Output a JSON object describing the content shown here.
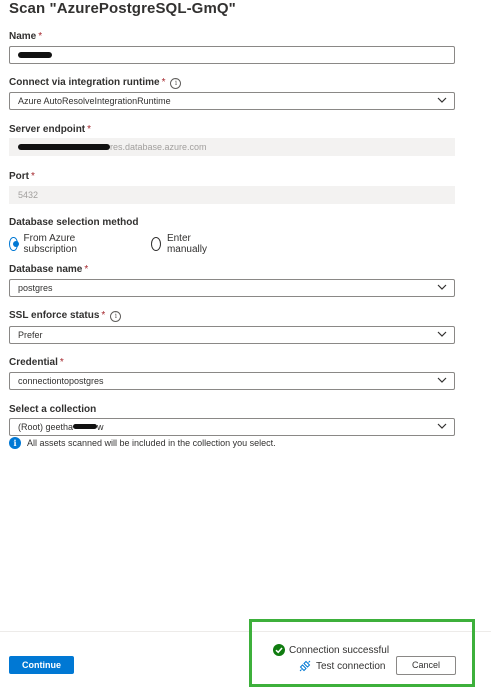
{
  "title": "Scan \"AzurePostgreSQL-GmQ\"",
  "required_mark": "*",
  "info_glyph": "i",
  "fields": {
    "name": {
      "label": "Name",
      "value": ""
    },
    "runtime": {
      "label": "Connect via integration runtime",
      "value": "Azure AutoResolveIntegrationRuntime"
    },
    "server_endpoint": {
      "label": "Server endpoint",
      "value_suffix": "res.database.azure.com"
    },
    "port": {
      "label": "Port",
      "value": "5432"
    },
    "db_selection": {
      "label": "Database selection method",
      "options": [
        "From Azure subscription",
        "Enter manually"
      ],
      "selected": "From Azure subscription"
    },
    "database_name": {
      "label": "Database name",
      "value": "postgres"
    },
    "ssl_status": {
      "label": "SSL enforce status",
      "value": "Prefer"
    },
    "credential": {
      "label": "Credential",
      "value": "connectiontopostgres"
    },
    "collection": {
      "label": "Select a collection",
      "value_prefix": "(Root) geetha",
      "value_suffix": "w",
      "note": "All assets scanned will be included in the collection you select."
    }
  },
  "footer": {
    "continue_label": "Continue",
    "status_text": "Connection successful",
    "test_connection_label": "Test connection",
    "cancel_label": "Cancel"
  },
  "colors": {
    "accent": "#0078d4",
    "success": "#107c10",
    "highlight_border": "#3db03b",
    "required": "#a4262c"
  },
  "icons": {
    "chevron": "chevron-down-icon",
    "info": "info-icon",
    "success": "checkmark-circle-icon",
    "plug": "plug-connect-icon"
  }
}
